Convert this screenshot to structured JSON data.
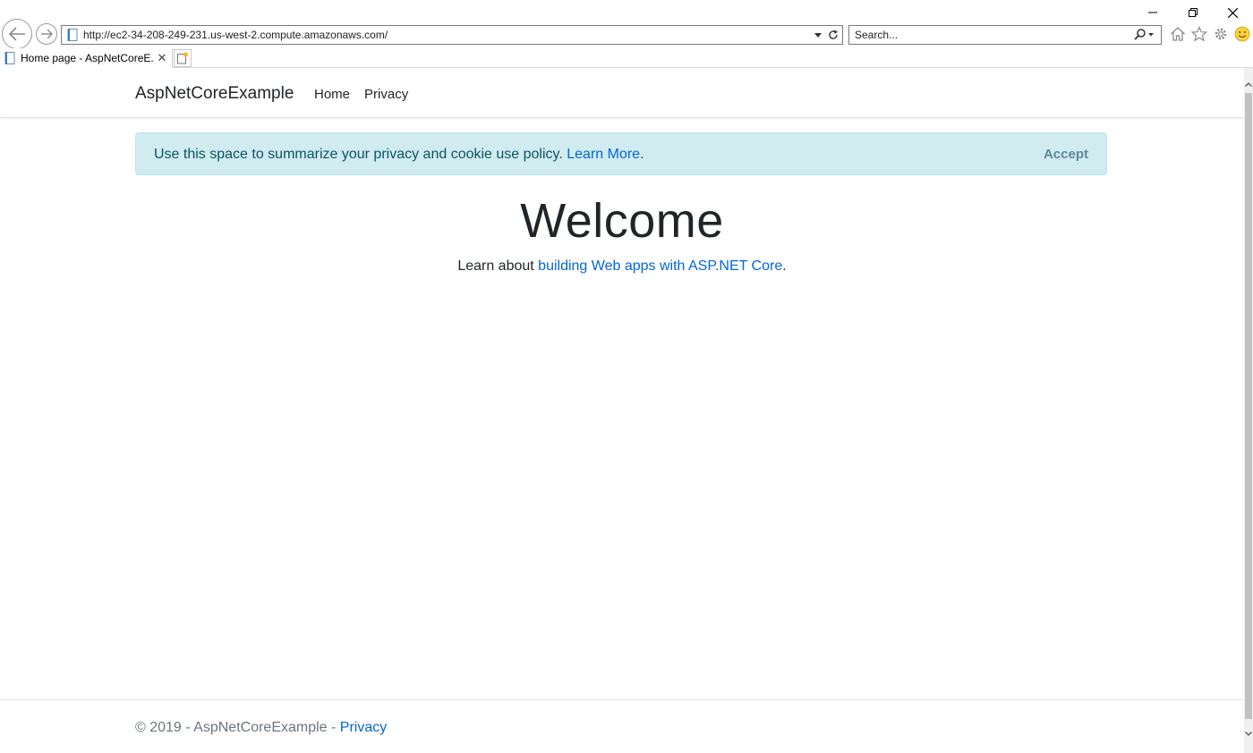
{
  "browser": {
    "address_url": "http://ec2-34-208-249-231.us-west-2.compute.amazonaws.com/",
    "search_placeholder": "Search...",
    "tab_title": "Home page - AspNetCoreE...",
    "tab_close": "✕"
  },
  "navbar": {
    "brand": "AspNetCoreExample",
    "links": [
      {
        "label": "Home"
      },
      {
        "label": "Privacy"
      }
    ]
  },
  "cookie_banner": {
    "text": "Use this space to summarize your privacy and cookie use policy.",
    "link_label": "Learn More",
    "text_end": ".",
    "accept_label": "Accept"
  },
  "main": {
    "heading": "Welcome",
    "lead_prefix": "Learn about",
    "lead_link": "building Web apps with ASP.NET Core",
    "lead_suffix": "."
  },
  "footer": {
    "copyright": "© 2019 - AspNetCoreExample -",
    "privacy_link": "Privacy"
  },
  "colors": {
    "link": "#0366d6",
    "alert_bg": "#d1ecf1",
    "alert_text": "#0c5460",
    "footer_text": "#6c757d"
  },
  "icons": [
    "back-arrow-icon",
    "forward-arrow-icon",
    "page-icon",
    "dropdown-icon",
    "refresh-icon",
    "search-icon",
    "home-icon",
    "favorites-star-icon",
    "settings-gear-icon",
    "feedback-smiley-icon",
    "minimize-icon",
    "restore-icon",
    "close-icon",
    "new-tab-icon"
  ]
}
